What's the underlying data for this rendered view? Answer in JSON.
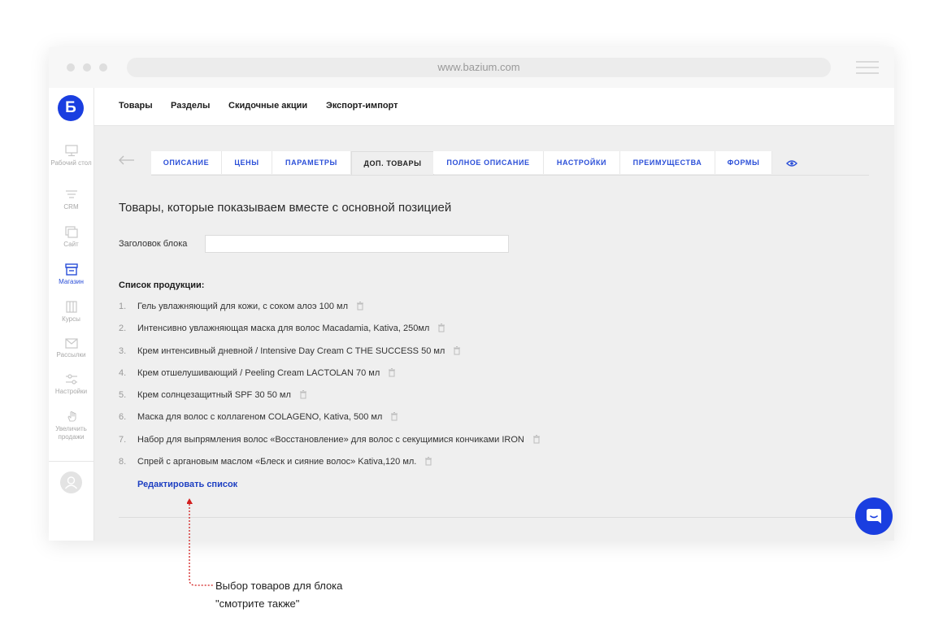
{
  "browser": {
    "url": "www.bazium.com"
  },
  "sidebar": {
    "logo": "Б",
    "items": [
      {
        "label": "Рабочий стол",
        "icon": "monitor-icon",
        "active": false
      },
      {
        "label": "CRM",
        "icon": "funnel-icon",
        "active": false
      },
      {
        "label": "Сайт",
        "icon": "site-icon",
        "active": false
      },
      {
        "label": "Магазин",
        "icon": "store-icon",
        "active": true
      },
      {
        "label": "Курсы",
        "icon": "courses-icon",
        "active": false
      },
      {
        "label": "Рассылки",
        "icon": "mail-icon",
        "active": false
      },
      {
        "label": "Настройки",
        "icon": "sliders-icon",
        "active": false
      },
      {
        "label": "Увеличить продажи",
        "icon": "hand-icon",
        "active": false
      }
    ]
  },
  "topnav": {
    "items": [
      "Товары",
      "Разделы",
      "Скидочные акции",
      "Экспорт-импорт"
    ]
  },
  "tabs": {
    "items": [
      "ОПИСАНИЕ",
      "ЦЕНЫ",
      "ПАРАМЕТРЫ",
      "ДОП. ТОВАРЫ",
      "ПОЛНОЕ ОПИСАНИЕ",
      "НАСТРОЙКИ",
      "ПРЕИМУЩЕСТВА",
      "ФОРМЫ"
    ],
    "active": "ДОП. ТОВАРЫ"
  },
  "main": {
    "heading": "Товары, которые показываем вместе с основной позицией",
    "block_title_label": "Заголовок блока",
    "block_title_value": "",
    "list_title": "Список продукции:",
    "products": [
      {
        "num": "1.",
        "name": "Гель увлажняющий для кожи, с соком алоэ 100 мл"
      },
      {
        "num": "2.",
        "name": "Интенсивно увлажняющая маска для волос Macadamia, Kativa, 250мл"
      },
      {
        "num": "3.",
        "name": "Крем интенсивный дневной / Intensive Day Cream C THE SUCCESS 50 мл"
      },
      {
        "num": "4.",
        "name": "Крем отшелушивающий / Peeling Cream LACTOLAN 70 мл"
      },
      {
        "num": "5.",
        "name": "Крем солнцезащитный SPF 30 50 мл"
      },
      {
        "num": "6.",
        "name": "Маска для волос с коллагеном COLAGENO, Kativa, 500 мл"
      },
      {
        "num": "7.",
        "name": "Набор для выпрямления волос «Восстановление» для волос с секущимися кончиками IRON"
      },
      {
        "num": "8.",
        "name": "Спрей с аргановым маслом «Блеск и сияние волос» Kativa,120 мл."
      }
    ],
    "edit_link": "Редактировать список"
  },
  "annotation": {
    "line1": "Выбор товаров для блока",
    "line2": "\"смотрите также\""
  },
  "colors": {
    "accent": "#1a3ee0",
    "link": "#1d3fc2",
    "tab_text": "#2b4fd8",
    "annotation_arrow": "#d21e1e",
    "content_bg": "#efefef"
  }
}
